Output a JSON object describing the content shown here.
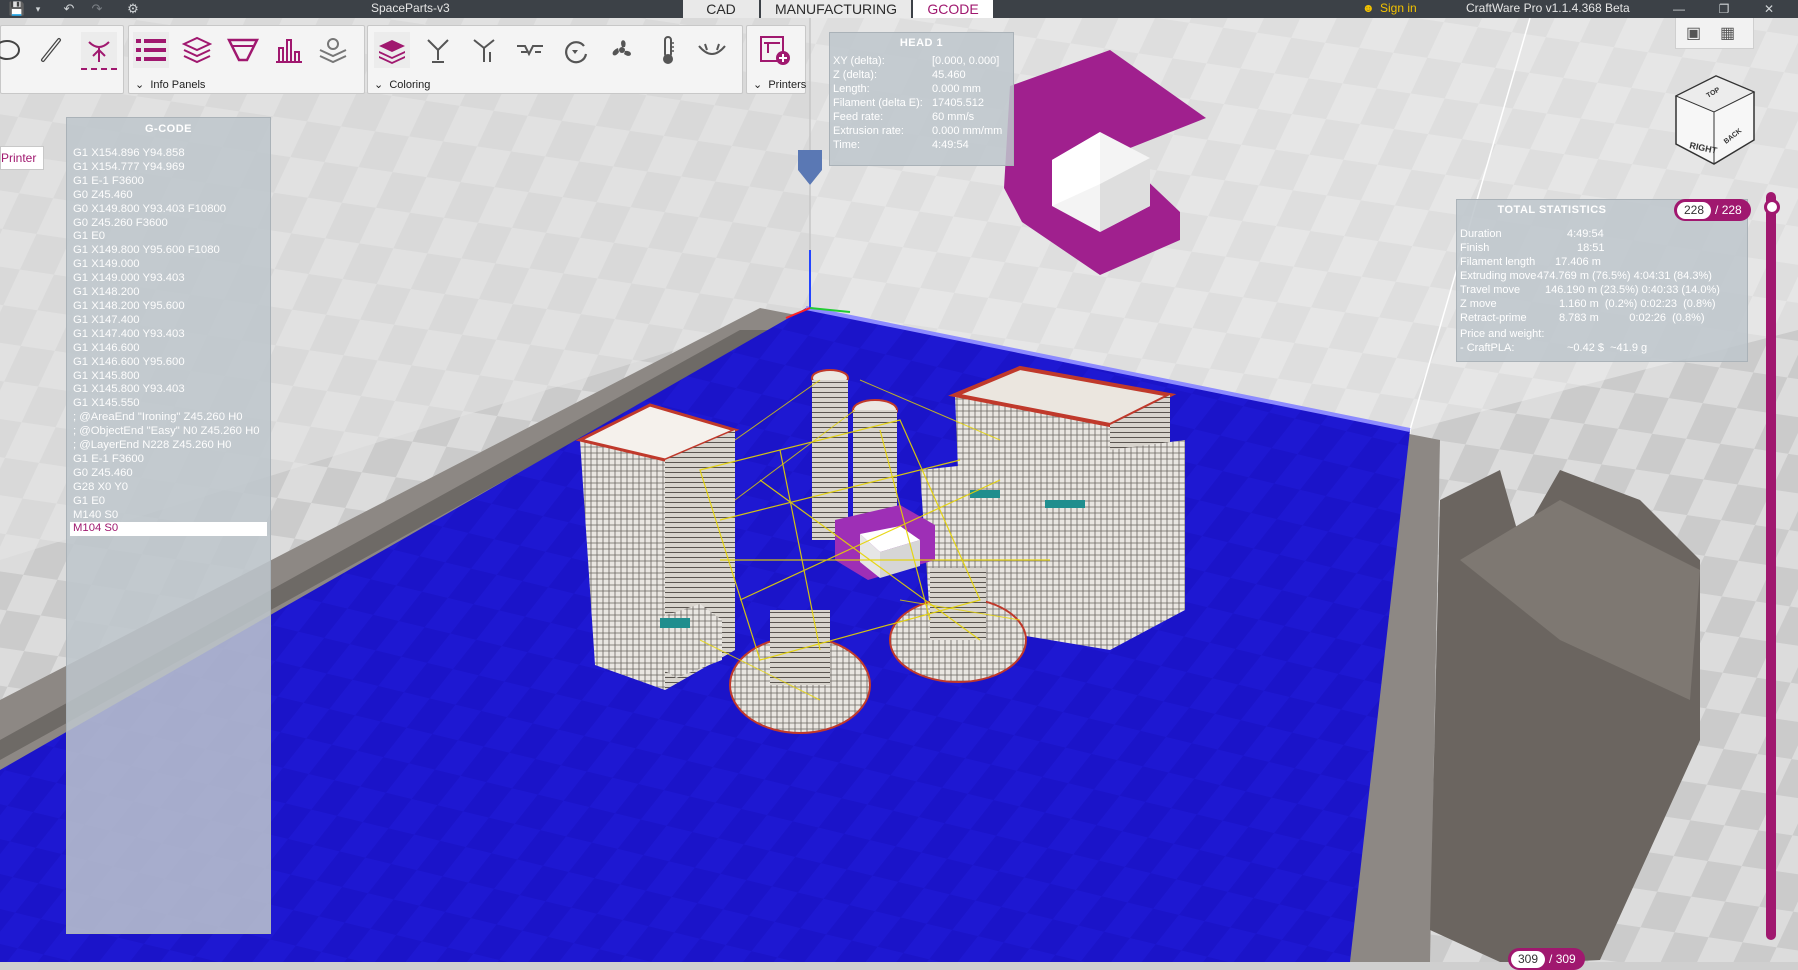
{
  "titlebar": {
    "document_title": "SpaceParts-v3",
    "app_title": "CraftWare Pro v1.1.4.368 Beta",
    "sign_in": "Sign in"
  },
  "mode_tabs": [
    "CAD",
    "MANUFACTURING",
    "GCODE"
  ],
  "active_mode": "GCODE",
  "ribbon": {
    "info_panels_label": "Info Panels",
    "coloring_label": "Coloring",
    "printers_label": "Printers"
  },
  "printer_tab": "Printer",
  "gcode": {
    "header": "G-CODE",
    "lines": [
      "G1 X154.896 Y94.858",
      "G1 X154.777 Y94.969",
      "G1 E-1 F3600",
      "G0 Z45.460",
      "G0 X149.800 Y93.403 F10800",
      "G0 Z45.260 F3600",
      "G1 E0",
      "G1 X149.800 Y95.600 F1080",
      "G1 X149.000",
      "G1 X149.000 Y93.403",
      "G1 X148.200",
      "G1 X148.200 Y95.600",
      "G1 X147.400",
      "G1 X147.400 Y93.403",
      "G1 X146.600",
      "G1 X146.600 Y95.600",
      "G1 X145.800",
      "G1 X145.800 Y93.403",
      "G1 X145.550",
      "; @AreaEnd \"Ironing\" Z45.260 H0",
      "; @ObjectEnd \"Easy\" N0 Z45.260 H0",
      "; @LayerEnd N228 Z45.260 H0",
      "G1 E-1 F3600",
      "G0 Z45.460",
      "G28 X0 Y0",
      "G1 E0",
      "M140 S0",
      "M104 S0"
    ],
    "selected_line": "M104 S0"
  },
  "head": {
    "header": "HEAD 1",
    "rows": [
      {
        "label": "XY (delta):",
        "value": "[0.000, 0.000]"
      },
      {
        "label": "Z (delta):",
        "value": "45.460"
      },
      {
        "label": "Length:",
        "value": "0.000 mm"
      },
      {
        "label": "Filament (delta E):",
        "value": "17405.512"
      },
      {
        "label": "Feed rate:",
        "value": "60 mm/s"
      },
      {
        "label": "Extrusion rate:",
        "value": "0.000 mm/mm"
      },
      {
        "label": "Time:",
        "value": "4:49:54"
      }
    ]
  },
  "stats": {
    "header": "TOTAL STATISTICS",
    "duration_label": "Duration",
    "duration": "4:49:54",
    "finish_label": "Finish",
    "finish": "18:51",
    "filament_label": "Filament length",
    "filament": "17.406 m",
    "extruding_label": "Extruding move",
    "extruding": "474.769 m (76.5%) 4:04:31 (84.3%)",
    "travel_label": "Travel move",
    "travel": "146.190 m (23.5%) 0:40:33 (14.0%)",
    "zmove_label": "Z move",
    "zmove": "1.160 m  (0.2%) 0:02:23  (0.8%)",
    "retract_label": "Retract-prime",
    "retract": "8.783 m          0:02:26  (0.8%)",
    "price_label": "Price and weight:",
    "material_label": "- CraftPLA:",
    "material": "~0.42 $  ~41.9 g"
  },
  "layer_slider": {
    "top_current": "228",
    "top_total": "/ 228",
    "bottom_current": "309",
    "bottom_total": "/ 309"
  },
  "view_cube": {
    "right": "RIGHT",
    "back": "BACK",
    "top": "TOP"
  },
  "colors": {
    "accent": "#a0186f",
    "bed": "#1b14c9",
    "titlebar": "#3c4147",
    "panel": "#bec6cc"
  }
}
